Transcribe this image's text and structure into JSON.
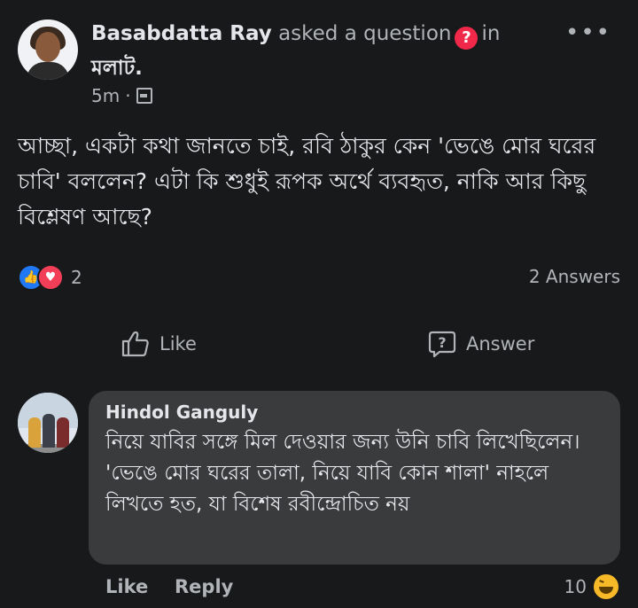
{
  "post": {
    "author": "Basabdatta Ray",
    "action_text": "asked a question",
    "in_text": "in",
    "group": "মলাট.",
    "time": "5m",
    "separator": "·",
    "more": "•••",
    "question": "আচ্ছা, একটা কথা জানতে চাই, রবি ঠাকুর কেন 'ভেঙে মোর ঘরের চাবি' বললেন? এটা কি শুধুই রূপক অর্থে ব্যবহৃত, নাকি আর কিছু বিশ্লেষণ আছে?",
    "reaction_count": "2",
    "answers_count": "2 Answers",
    "like_label": "Like",
    "answer_label": "Answer",
    "icons": {
      "question_badge": "?",
      "privacy": "photo-icon",
      "like_reaction": "👍",
      "love_reaction": "♥"
    }
  },
  "comment": {
    "author": "Hindol Ganguly",
    "line1": "নিয়ে যাবির সঙ্গে মিল দেওয়ার জন্য উনি চাবি লিখেছিলেন।",
    "line2": "'ভেঙে মোর ঘরের তালা, নিয়ে যাবি কোন শালা' নাহলে লিখতে হত, যা বিশেষ রবীন্দ্রোচিত নয়",
    "like_label": "Like",
    "reply_label": "Reply",
    "reaction_count": "10"
  },
  "colors": {
    "background": "#18191a",
    "bubble": "#3a3b3c",
    "text": "#e4e6eb",
    "muted": "#b0b3b8",
    "like_blue": "#2078f4",
    "love_red": "#f33e58",
    "question_red": "#f02849",
    "haha_yellow": "#f7b928"
  }
}
